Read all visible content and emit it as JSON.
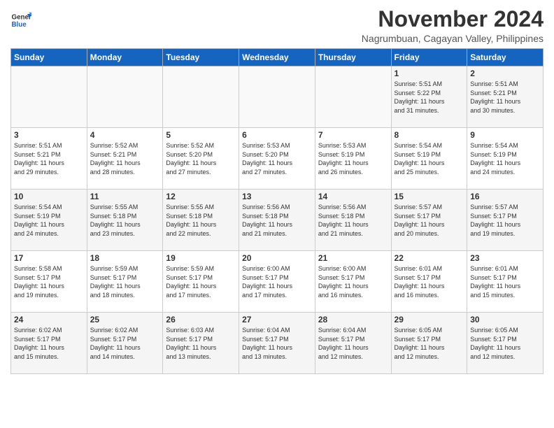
{
  "logo": {
    "line1": "General",
    "line2": "Blue"
  },
  "title": "November 2024",
  "location": "Nagrumbuan, Cagayan Valley, Philippines",
  "days_of_week": [
    "Sunday",
    "Monday",
    "Tuesday",
    "Wednesday",
    "Thursday",
    "Friday",
    "Saturday"
  ],
  "weeks": [
    [
      {
        "num": "",
        "info": ""
      },
      {
        "num": "",
        "info": ""
      },
      {
        "num": "",
        "info": ""
      },
      {
        "num": "",
        "info": ""
      },
      {
        "num": "",
        "info": ""
      },
      {
        "num": "1",
        "info": "Sunrise: 5:51 AM\nSunset: 5:22 PM\nDaylight: 11 hours\nand 31 minutes."
      },
      {
        "num": "2",
        "info": "Sunrise: 5:51 AM\nSunset: 5:21 PM\nDaylight: 11 hours\nand 30 minutes."
      }
    ],
    [
      {
        "num": "3",
        "info": "Sunrise: 5:51 AM\nSunset: 5:21 PM\nDaylight: 11 hours\nand 29 minutes."
      },
      {
        "num": "4",
        "info": "Sunrise: 5:52 AM\nSunset: 5:21 PM\nDaylight: 11 hours\nand 28 minutes."
      },
      {
        "num": "5",
        "info": "Sunrise: 5:52 AM\nSunset: 5:20 PM\nDaylight: 11 hours\nand 27 minutes."
      },
      {
        "num": "6",
        "info": "Sunrise: 5:53 AM\nSunset: 5:20 PM\nDaylight: 11 hours\nand 27 minutes."
      },
      {
        "num": "7",
        "info": "Sunrise: 5:53 AM\nSunset: 5:19 PM\nDaylight: 11 hours\nand 26 minutes."
      },
      {
        "num": "8",
        "info": "Sunrise: 5:54 AM\nSunset: 5:19 PM\nDaylight: 11 hours\nand 25 minutes."
      },
      {
        "num": "9",
        "info": "Sunrise: 5:54 AM\nSunset: 5:19 PM\nDaylight: 11 hours\nand 24 minutes."
      }
    ],
    [
      {
        "num": "10",
        "info": "Sunrise: 5:54 AM\nSunset: 5:19 PM\nDaylight: 11 hours\nand 24 minutes."
      },
      {
        "num": "11",
        "info": "Sunrise: 5:55 AM\nSunset: 5:18 PM\nDaylight: 11 hours\nand 23 minutes."
      },
      {
        "num": "12",
        "info": "Sunrise: 5:55 AM\nSunset: 5:18 PM\nDaylight: 11 hours\nand 22 minutes."
      },
      {
        "num": "13",
        "info": "Sunrise: 5:56 AM\nSunset: 5:18 PM\nDaylight: 11 hours\nand 21 minutes."
      },
      {
        "num": "14",
        "info": "Sunrise: 5:56 AM\nSunset: 5:18 PM\nDaylight: 11 hours\nand 21 minutes."
      },
      {
        "num": "15",
        "info": "Sunrise: 5:57 AM\nSunset: 5:17 PM\nDaylight: 11 hours\nand 20 minutes."
      },
      {
        "num": "16",
        "info": "Sunrise: 5:57 AM\nSunset: 5:17 PM\nDaylight: 11 hours\nand 19 minutes."
      }
    ],
    [
      {
        "num": "17",
        "info": "Sunrise: 5:58 AM\nSunset: 5:17 PM\nDaylight: 11 hours\nand 19 minutes."
      },
      {
        "num": "18",
        "info": "Sunrise: 5:59 AM\nSunset: 5:17 PM\nDaylight: 11 hours\nand 18 minutes."
      },
      {
        "num": "19",
        "info": "Sunrise: 5:59 AM\nSunset: 5:17 PM\nDaylight: 11 hours\nand 17 minutes."
      },
      {
        "num": "20",
        "info": "Sunrise: 6:00 AM\nSunset: 5:17 PM\nDaylight: 11 hours\nand 17 minutes."
      },
      {
        "num": "21",
        "info": "Sunrise: 6:00 AM\nSunset: 5:17 PM\nDaylight: 11 hours\nand 16 minutes."
      },
      {
        "num": "22",
        "info": "Sunrise: 6:01 AM\nSunset: 5:17 PM\nDaylight: 11 hours\nand 16 minutes."
      },
      {
        "num": "23",
        "info": "Sunrise: 6:01 AM\nSunset: 5:17 PM\nDaylight: 11 hours\nand 15 minutes."
      }
    ],
    [
      {
        "num": "24",
        "info": "Sunrise: 6:02 AM\nSunset: 5:17 PM\nDaylight: 11 hours\nand 15 minutes."
      },
      {
        "num": "25",
        "info": "Sunrise: 6:02 AM\nSunset: 5:17 PM\nDaylight: 11 hours\nand 14 minutes."
      },
      {
        "num": "26",
        "info": "Sunrise: 6:03 AM\nSunset: 5:17 PM\nDaylight: 11 hours\nand 13 minutes."
      },
      {
        "num": "27",
        "info": "Sunrise: 6:04 AM\nSunset: 5:17 PM\nDaylight: 11 hours\nand 13 minutes."
      },
      {
        "num": "28",
        "info": "Sunrise: 6:04 AM\nSunset: 5:17 PM\nDaylight: 11 hours\nand 12 minutes."
      },
      {
        "num": "29",
        "info": "Sunrise: 6:05 AM\nSunset: 5:17 PM\nDaylight: 11 hours\nand 12 minutes."
      },
      {
        "num": "30",
        "info": "Sunrise: 6:05 AM\nSunset: 5:17 PM\nDaylight: 11 hours\nand 12 minutes."
      }
    ]
  ]
}
